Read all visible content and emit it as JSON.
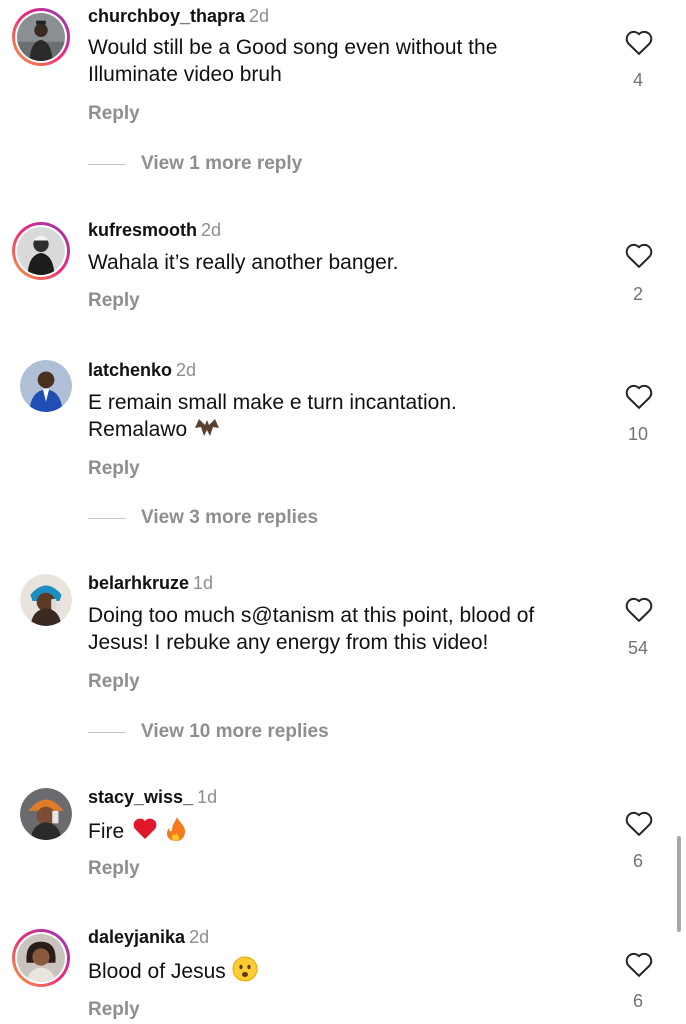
{
  "reply_label": "Reply",
  "colors": {
    "username": "#111111",
    "secondary": "#8e8e8e",
    "story_ring": [
      "#f9a13a",
      "#ee2a7b",
      "#8a3ab9"
    ]
  },
  "comments": [
    {
      "username": "churchboy_thapra",
      "time": "2d",
      "text": "Would still be a Good song even without the Illuminate video bruh",
      "likes": "4",
      "view_more": "View 1 more reply",
      "avatar": "story-ring"
    },
    {
      "username": "kufresmooth",
      "time": "2d",
      "text": "Wahala it’s really another banger.",
      "likes": "2",
      "avatar": "story-ring"
    },
    {
      "username": "latchenko",
      "time": "2d",
      "text": "E remain small make e turn incantation. Remalawo",
      "emoji": "bat-emoji",
      "likes": "10",
      "view_more": "View 3 more replies",
      "avatar": "plain"
    },
    {
      "username": "belarhkruze",
      "time": "1d",
      "text": "Doing too much s@tanism at this point, blood of Jesus! I rebuke any energy from this video!",
      "likes": "54",
      "view_more": "View 10 more replies",
      "avatar": "plain"
    },
    {
      "username": "stacy_wiss_",
      "time": "1d",
      "text": "Fire",
      "emoji": "heart-fire-emoji",
      "likes": "6",
      "avatar": "plain"
    },
    {
      "username": "daleyjanika",
      "time": "2d",
      "text": "Blood of Jesus",
      "emoji": "frowning-emoji",
      "likes": "6",
      "avatar": "story-ring"
    }
  ]
}
